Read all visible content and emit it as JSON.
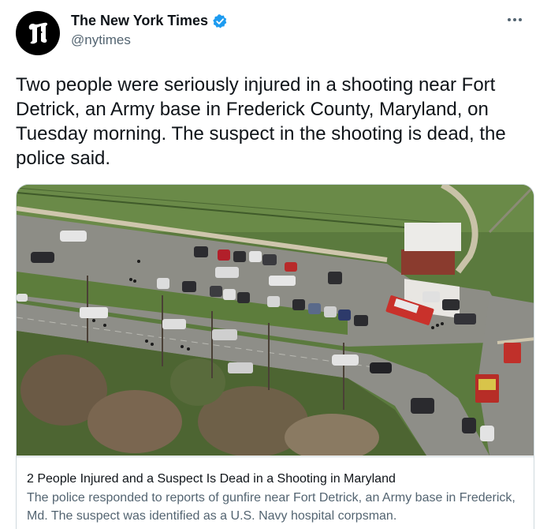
{
  "author": {
    "display_name": "The New York Times",
    "handle": "@nytimes",
    "avatar_icon": "nyt-t-logo-icon",
    "verified_icon": "verified-badge-icon",
    "verified_color": "#1d9bf0"
  },
  "menu_icon": "more-options-icon",
  "tweet": {
    "text": "Two people were seriously injured in a shooting near Fort Detrick, an Army base in Frederick County, Maryland, on Tuesday morning. The suspect in the shooting is dead, the police said."
  },
  "card": {
    "image_description_icon": "aerial-photo",
    "title": "2 People Injured and a Suspect Is Dead in a Shooting in Maryland",
    "description": "The police responded to reports of gunfire near Fort Detrick, an Army base in Frederick, Md. The suspect was identified as a U.S. Navy hospital corpsman."
  },
  "colors": {
    "text_primary": "#0f1419",
    "text_secondary": "#536471",
    "border": "#cfd9de"
  }
}
